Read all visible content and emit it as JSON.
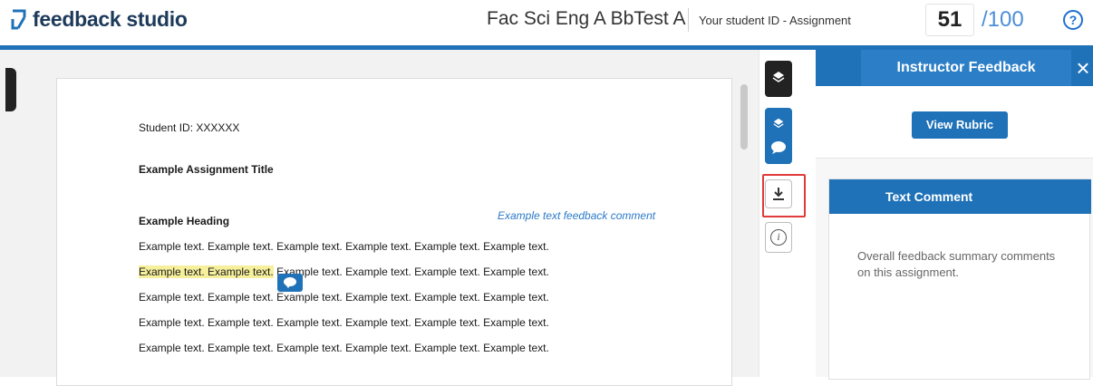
{
  "brand": {
    "name": "feedback studio"
  },
  "header": {
    "class_title": "Fac Sci Eng A BbTest A",
    "assignment_title": "Your student ID - Assignment",
    "score": "51",
    "score_total": "/100",
    "help_icon_glyph": "?"
  },
  "document": {
    "student_id": "Student ID: XXXXXX",
    "assignment_title": "Example Assignment Title",
    "heading": "Example Heading",
    "feedback_comment": "Example text feedback comment",
    "highlighted_text": "Example text. Example text.",
    "line_2_rest": " Example text. Example text. Example text. Example text.",
    "lines": [
      "Example text. Example text. Example text. Example text. Example text. Example text.",
      "Example text. Example text. Example text. Example text. Example text. Example text.",
      "Example text. Example text. Example text. Example text. Example text. Example text.",
      "Example text. Example text. Example text. Example text. Example text. Example text."
    ]
  },
  "tools": {
    "layers_icon": "layers-icon",
    "comment_icon": "comment-icon",
    "download_icon": "download-icon",
    "info_icon": "info-icon"
  },
  "panel": {
    "title": "Instructor Feedback",
    "close_glyph": "×",
    "rubric_button": "View Rubric",
    "text_comment_title": "Text Comment",
    "text_comment_body": "Overall feedback summary comments on this assignment."
  },
  "colors": {
    "accent": "#1f72b8",
    "highlight": "#f6ef9c",
    "comment_text": "#2c7ac8",
    "download_highlight_border": "#e03a3a"
  }
}
